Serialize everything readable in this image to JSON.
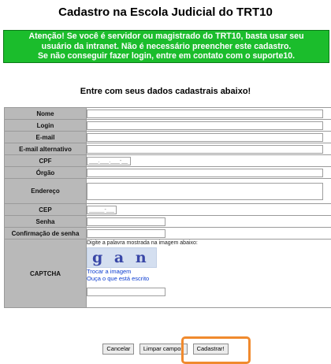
{
  "page": {
    "title": "Cadastro na Escola Judicial do TRT10"
  },
  "notice": {
    "line1": "Atenção! Se você é servidor ou magistrado do TRT10, basta usar seu",
    "line2": "usuário da intranet. Não é necessário preencher este cadastro.",
    "line3": "Se não conseguir fazer login, entre em contato com o suporte10."
  },
  "form": {
    "subtitle": "Entre com seus dados cadastrais abaixo!",
    "labels": {
      "nome": "Nome",
      "login": "Login",
      "email": "E-mail",
      "email_alt": "E-mail alternativo",
      "cpf": "CPF",
      "orgao": "Órgão",
      "endereco": "Endereço",
      "cep": "CEP",
      "senha": "Senha",
      "confirm": "Confirmação de senha",
      "captcha": "CAPTCHA"
    },
    "values": {
      "nome": "",
      "login": "",
      "email": "",
      "email_alt": "",
      "cpf": "___.___.___-__",
      "orgao": "",
      "endereco": "",
      "cep": "_____-___",
      "senha": "",
      "confirm": "",
      "captcha": ""
    },
    "captcha": {
      "instruction": "Digite a palavra mostrada na imagem abaixo:",
      "image_text": "g a n s o",
      "refresh_link": "Trocar a imagem",
      "audio_link": "Ouça o que está escrito"
    }
  },
  "buttons": {
    "cancel": "Cancelar",
    "clear": "Limpar campos",
    "submit": "Cadastrar!"
  },
  "colors": {
    "notice_bg": "#1bbd2c",
    "label_bg": "#b9b9b9",
    "highlight": "#f08a2e",
    "link": "#0b3cd0"
  }
}
